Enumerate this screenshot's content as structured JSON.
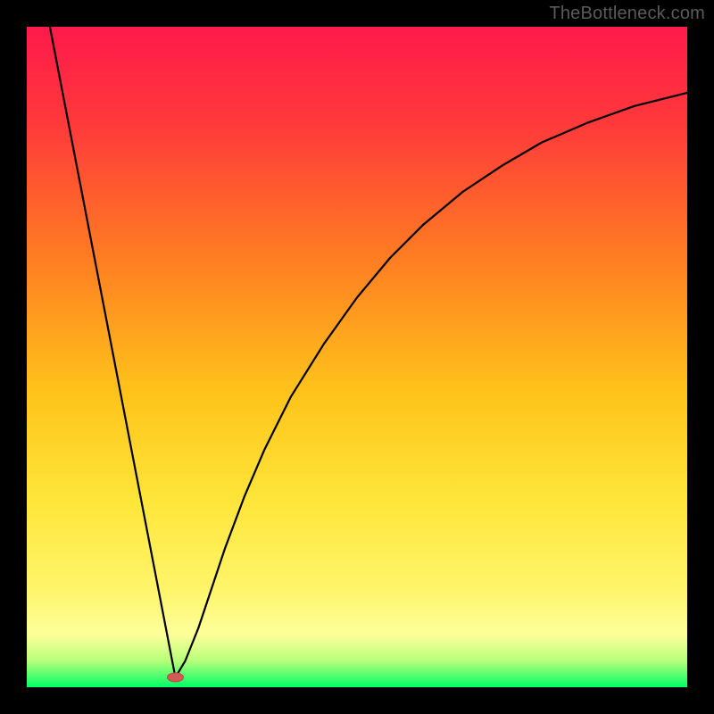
{
  "watermark": "TheBottleneck.com",
  "chart_data": {
    "type": "line",
    "title": "",
    "xlabel": "",
    "ylabel": "",
    "xlim": [
      0,
      100
    ],
    "ylim": [
      0,
      100
    ],
    "grid": false,
    "legend": false,
    "background_gradient": {
      "type": "vertical",
      "stops": [
        {
          "offset": 0.0,
          "color": "#ff1a4b"
        },
        {
          "offset": 0.15,
          "color": "#ff3a3a"
        },
        {
          "offset": 0.35,
          "color": "#ff7d22"
        },
        {
          "offset": 0.55,
          "color": "#ffc21a"
        },
        {
          "offset": 0.72,
          "color": "#ffe63a"
        },
        {
          "offset": 0.85,
          "color": "#fff56a"
        },
        {
          "offset": 0.92,
          "color": "#fdff9a"
        },
        {
          "offset": 0.96,
          "color": "#b8ff7a"
        },
        {
          "offset": 1.0,
          "color": "#00ff66"
        }
      ]
    },
    "series": [
      {
        "name": "left-branch",
        "type": "line",
        "color": "#000000",
        "width": 2.2,
        "x": [
          3.5,
          22.5
        ],
        "values": [
          100,
          1.5
        ]
      },
      {
        "name": "right-branch",
        "type": "line",
        "color": "#000000",
        "width": 2.2,
        "x": [
          22.5,
          24,
          26,
          28,
          30,
          33,
          36,
          40,
          45,
          50,
          55,
          60,
          66,
          72,
          78,
          85,
          92,
          100
        ],
        "values": [
          1.5,
          4,
          9,
          15,
          21,
          29,
          36,
          44,
          52,
          59,
          65,
          70,
          75,
          79,
          82.5,
          85.5,
          88,
          90
        ]
      }
    ],
    "marker": {
      "name": "bottleneck-point",
      "x": 22.5,
      "y": 1.5,
      "rx": 9,
      "ry": 5,
      "fill": "#d15a55",
      "stroke": "#b94a45"
    }
  }
}
